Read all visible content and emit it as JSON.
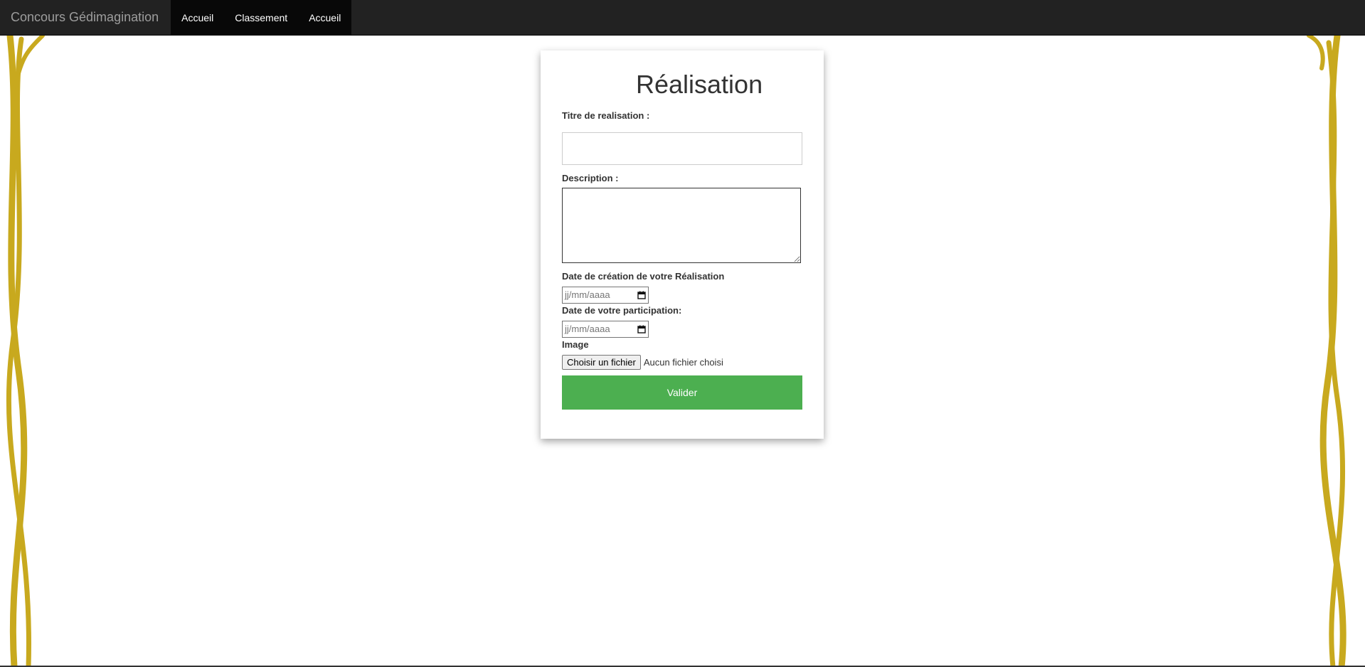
{
  "navbar": {
    "brand": "Concours Gédimagination",
    "items": [
      {
        "label": "Accueil"
      },
      {
        "label": "Classement"
      },
      {
        "label": "Accueil"
      }
    ]
  },
  "form": {
    "title": "Réalisation",
    "fields": {
      "title_label": "Titre de realisation :",
      "title_value": "",
      "description_label": "Description :",
      "description_value": "",
      "creation_date_label": "Date de création de votre Réalisation",
      "creation_date_placeholder": "jj/mm/aaaa",
      "participation_date_label": "Date de votre participation:",
      "participation_date_placeholder": "jj/mm/aaaa",
      "image_label": "Image",
      "file_button_label": "Choisir un fichier",
      "file_status": "Aucun fichier choisi"
    },
    "submit_label": "Valider"
  },
  "colors": {
    "navbar_bg": "#222222",
    "nav_active_bg": "#080808",
    "submit_bg": "#4caf50",
    "ribbon": "#c8a91e"
  },
  "icons": {
    "date_picker": "calendar-icon"
  }
}
